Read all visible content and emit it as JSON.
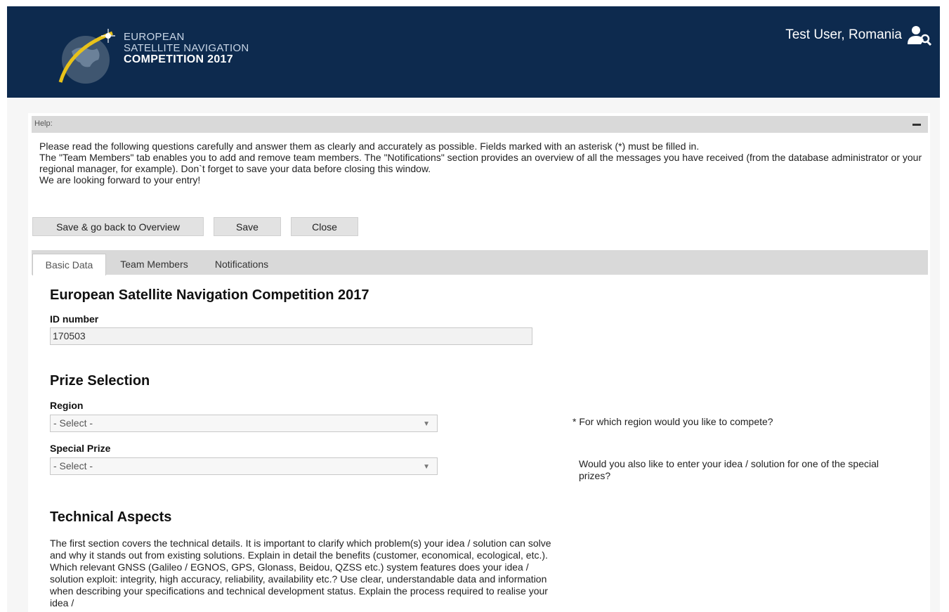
{
  "header": {
    "logo_line1": "EUROPEAN",
    "logo_line2": "SATELLITE NAVIGATION",
    "logo_line3": "COMPETITION 2017",
    "user_label": "Test User, Romania",
    "user_icon": "user-search-icon",
    "bg_color": "#0d2a4e"
  },
  "help": {
    "title": "Help:",
    "line1": "Please read the following questions carefully and answer them as clearly and accurately as possible. Fields marked with an asterisk (*) must be filled in.",
    "line2": "The \"Team Members\" tab enables you to add and remove team members. The \"Notifications\" section provides an overview of all the messages you have received (from the database administrator or your regional manager, for example). Don`t forget to save your data before closing this window.",
    "line3": "We are looking forward to your entry!"
  },
  "buttons": {
    "save_back": "Save & go back to Overview",
    "save": "Save",
    "close": "Close"
  },
  "tabs": [
    {
      "label": "Basic Data",
      "active": true
    },
    {
      "label": "Team Members",
      "active": false
    },
    {
      "label": "Notifications",
      "active": false
    }
  ],
  "form": {
    "title": "European Satellite Navigation Competition 2017",
    "id_label": "ID number",
    "id_value": "170503",
    "prize_heading": "Prize Selection",
    "region_label": "Region",
    "region_value": "- Select -",
    "region_hint": "* For which region would you like to compete?",
    "special_label": "Special Prize",
    "special_value": "- Select -",
    "special_hint": "Would you also like to enter your idea / solution for one of the special prizes?",
    "tech_heading": "Technical Aspects",
    "tech_text": "The first section covers the technical details. It is important to clarify which problem(s) your idea / solution can solve and why it stands out from existing solutions. Explain in detail the benefits (customer, economical, ecological, etc.). Which relevant GNSS (Galileo / EGNOS, GPS, Glonass, Beidou, QZSS etc.) system features does your idea / solution exploit: integrity, high accuracy, reliability, availability etc.? Use clear, understandable data and information when describing your specifications and technical development status. Explain the process required to realise your idea /"
  }
}
